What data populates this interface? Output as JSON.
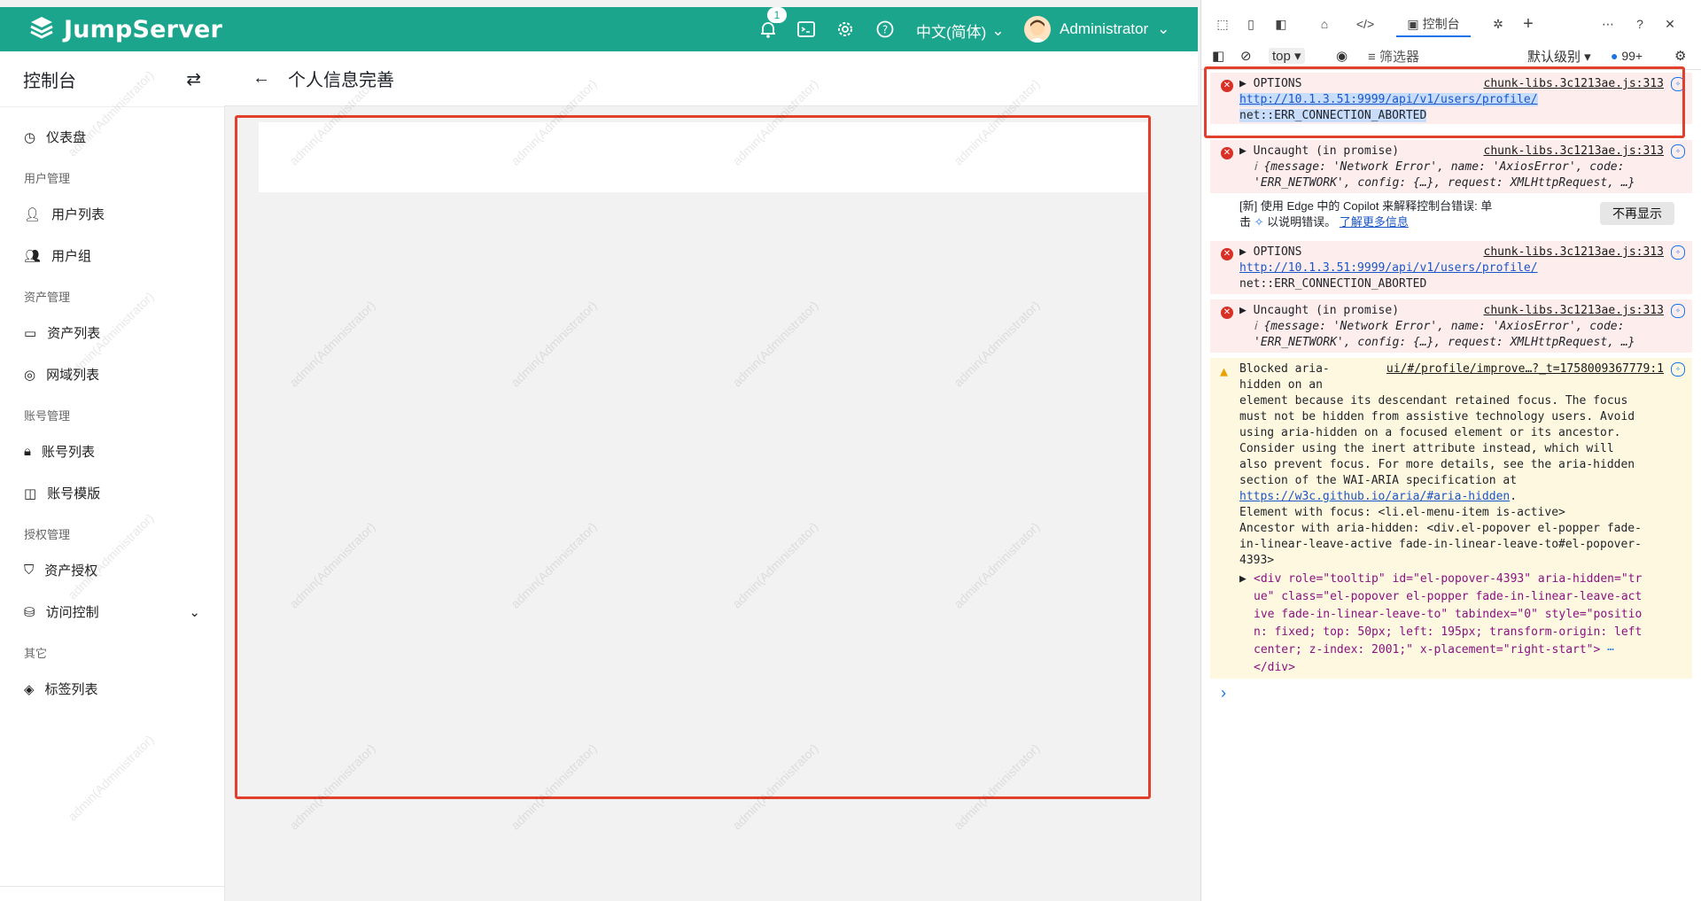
{
  "app": {
    "brand": "JumpServer",
    "notification_count": "1",
    "language": "中文(简体)",
    "user_name": "Administrator",
    "sidebar_title": "控制台",
    "page_title": "个人信息完善",
    "watermark": "admin(Administrator)"
  },
  "sidebar": {
    "dashboard": "仪表盘",
    "groups": [
      {
        "title": "用户管理",
        "items": [
          "用户列表",
          "用户组"
        ]
      },
      {
        "title": "资产管理",
        "items": [
          "资产列表",
          "网域列表"
        ]
      },
      {
        "title": "账号管理",
        "items": [
          "账号列表",
          "账号模版"
        ]
      },
      {
        "title": "授权管理",
        "items": [
          "资产授权",
          "访问控制"
        ]
      },
      {
        "title": "其它",
        "items": [
          "标签列表"
        ]
      }
    ]
  },
  "devtools": {
    "console_tab": "控制台",
    "context": "top",
    "filter": "筛选器",
    "level": "默认级别",
    "issues_count": "99+",
    "logs": [
      {
        "type": "error",
        "text": "OPTIONS",
        "source": "chunk-libs.3c1213ae.js:313",
        "url": "http://10.1.3.51:9999/api/v1/users/profile/",
        "detail": "net::ERR_CONNECTION_ABORTED"
      },
      {
        "type": "error",
        "text": "Uncaught (in promise)",
        "source": "chunk-libs.3c1213ae.js:313",
        "line1": "{message: 'Network Error', name: 'AxiosError', code:",
        "line2": "'ERR_NETWORK', config: {…}, request: XMLHttpRequest, …}"
      },
      {
        "type": "info",
        "text1": "[新] 使用 Edge 中的 Copilot 来解释控制台错误: 单",
        "text2": "击",
        "text3": "以说明错误。",
        "link": "了解更多信息",
        "button": "不再显示"
      },
      {
        "type": "error",
        "text": "OPTIONS",
        "source": "chunk-libs.3c1213ae.js:313",
        "url": "http://10.1.3.51:9999/api/v1/users/profile/",
        "detail": "net::ERR_CONNECTION_ABORTED"
      },
      {
        "type": "error",
        "text": "Uncaught (in promise)",
        "source": "chunk-libs.3c1213ae.js:313",
        "line1": "{message: 'Network Error', name: 'AxiosError', code:",
        "line2": "'ERR_NETWORK', config: {…}, request: XMLHttpRequest, …}"
      },
      {
        "type": "warning",
        "head1": "Blocked aria-",
        "head2": "hidden on an",
        "source": "ui/#/profile/improve…?_t=1758009367779:1",
        "body": [
          "element because its descendant retained focus. The focus",
          "must not be hidden from assistive technology users. Avoid",
          "using aria-hidden on a focused element or its ancestor.",
          "Consider using the inert attribute instead, which will",
          "also prevent focus. For more details, see the aria-hidden",
          "section of the WAI-ARIA specification at"
        ],
        "spec_link": "https://w3c.github.io/aria/#aria-hidden",
        "focus_line": "Element with focus: <li.el-menu-item is-active>",
        "ancestor": [
          "Ancestor with aria-hidden: <div.el-popover el-popper fade-",
          "in-linear-leave-active fade-in-linear-leave-to#el-popover-",
          "4393>"
        ],
        "html": [
          "<div role=\"tooltip\" id=\"el-popover-4393\" aria-hidden=\"tr",
          "ue\" class=\"el-popover el-popper fade-in-linear-leave-act",
          "ive fade-in-linear-leave-to\" tabindex=\"0\" style=\"positio",
          "n: fixed; top: 50px; left: 195px; transform-origin: left",
          "center; z-index: 2001;\" x-placement=\"right-start\">"
        ],
        "html_close": "</div>"
      }
    ],
    "prompt": "›"
  },
  "colors": {
    "brand": "#1ba58c",
    "highlight": "#e0402c",
    "error_bg": "#fdeded",
    "warning_bg": "#fff8e0"
  }
}
